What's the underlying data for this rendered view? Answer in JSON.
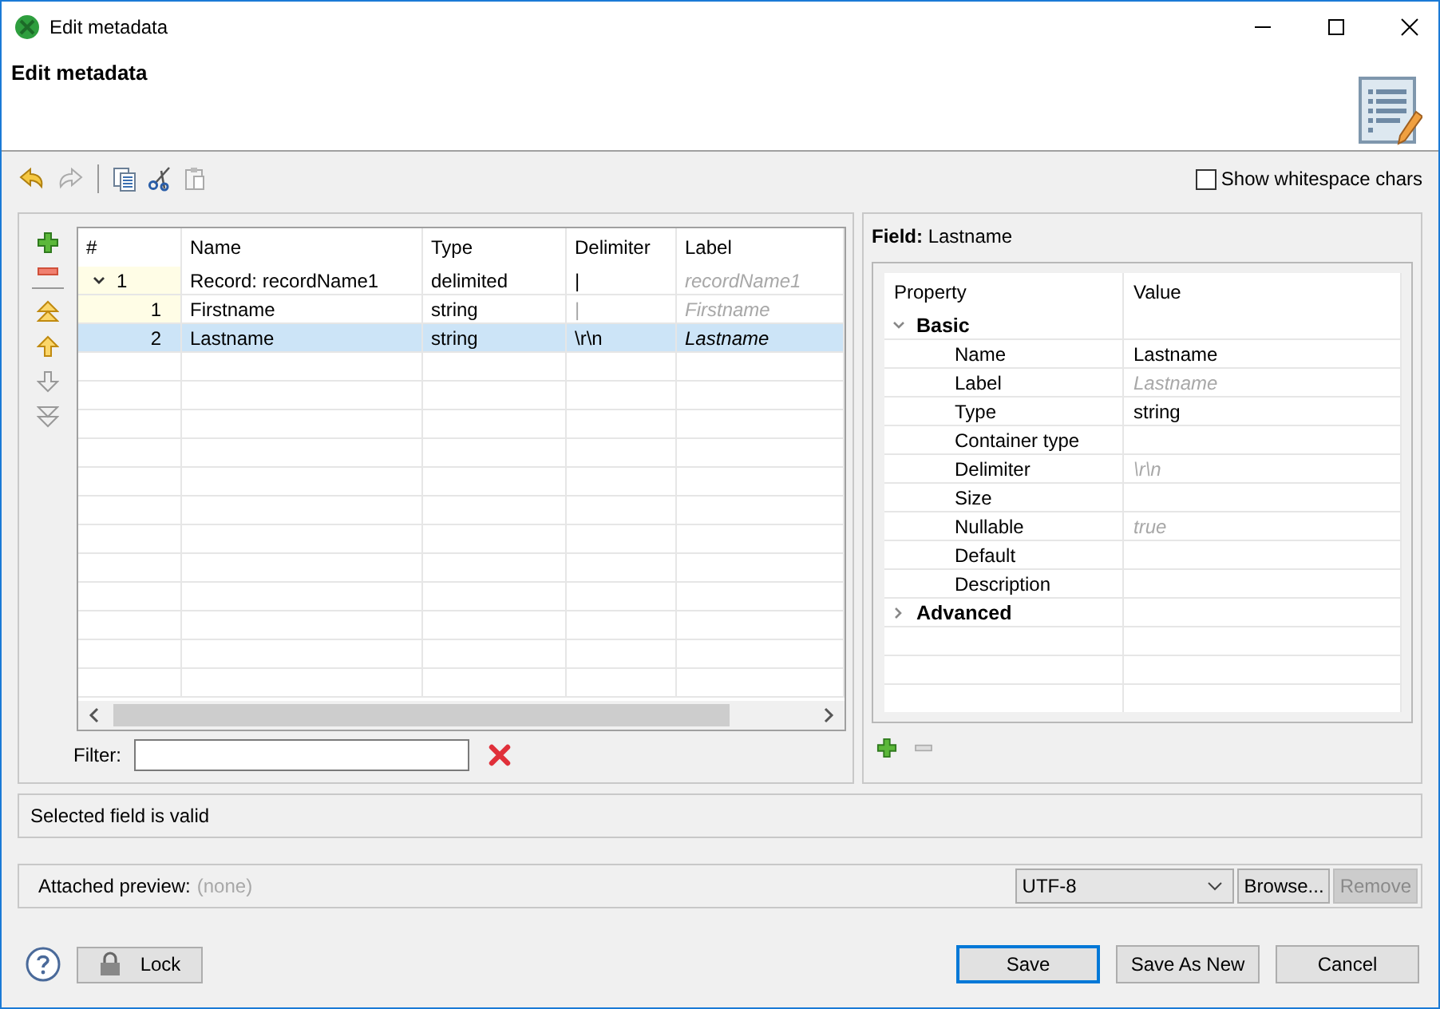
{
  "window": {
    "title": "Edit metadata"
  },
  "header": {
    "title": "Edit metadata"
  },
  "toolbar": [
    {
      "kind": "undo",
      "disabled": false
    },
    {
      "kind": "redo",
      "disabled": true
    },
    {
      "kind": "separator"
    },
    {
      "kind": "copy",
      "disabled": false
    },
    {
      "kind": "cut",
      "disabled": false
    },
    {
      "kind": "paste",
      "disabled": true
    }
  ],
  "show_whitespace": {
    "label": "Show whitespace chars",
    "checked": false
  },
  "side_buttons": [
    {
      "kind": "add",
      "disabled": false
    },
    {
      "kind": "remove",
      "disabled": false
    },
    {
      "kind": "separator"
    },
    {
      "kind": "top",
      "disabled": false
    },
    {
      "kind": "up",
      "disabled": false
    },
    {
      "kind": "down",
      "disabled": true
    },
    {
      "kind": "bottom",
      "disabled": true
    }
  ],
  "table": {
    "columns": [
      "#",
      "Name",
      "Type",
      "Delimiter",
      "Label"
    ],
    "rows": [
      {
        "number": "1",
        "name": "Record: recordName1",
        "type": "delimited",
        "delimiter": "|",
        "delimiter_default": false,
        "label": "recordName1",
        "selected": false,
        "expanded": true,
        "children": [
          {
            "number": "1",
            "name": "Firstname",
            "type": "string",
            "delimiter": "|",
            "delimiter_default": true,
            "label": "Firstname",
            "selected": false
          },
          {
            "number": "2",
            "name": "Lastname",
            "type": "string",
            "delimiter": "\\r\\n",
            "delimiter_default": false,
            "label": "Lastname",
            "selected": true
          }
        ]
      }
    ]
  },
  "filter": {
    "label": "Filter:"
  },
  "field_panel": {
    "title": "**Field:** Lastname",
    "columns": [
      "Property",
      "Value"
    ],
    "groups": [
      {
        "name": "Basic",
        "expanded": true,
        "items": [
          {
            "name": "Name",
            "value": "Lastname",
            "default": false
          },
          {
            "name": "Label",
            "value": "Lastname",
            "default": true
          },
          {
            "name": "Type",
            "value": "string",
            "default": false
          },
          {
            "name": "Container type"
          },
          {
            "name": "Delimiter",
            "value": "\\r\\n",
            "default": true
          },
          {
            "name": "Size"
          },
          {
            "name": "Nullable",
            "value": "true",
            "default": true
          },
          {
            "name": "Default"
          },
          {
            "name": "Description"
          }
        ]
      },
      {
        "name": "Advanced",
        "expanded": false
      }
    ],
    "buttons": [
      {
        "kind": "add",
        "disabled": false
      },
      {
        "kind": "remove",
        "disabled": true
      }
    ]
  },
  "status": "Selected field is valid",
  "preview": {
    "label": "Attached preview:",
    "value": "(none)",
    "encoding": "UTF-8",
    "browse": {
      "label": "Browse...",
      "disabled": false
    },
    "remove": {
      "label": "Remove",
      "disabled": true
    }
  },
  "footer": {
    "lock": "Lock",
    "buttons": [
      {
        "label": "Save",
        "default": true
      },
      {
        "label": "Save As New",
        "default": false
      },
      {
        "label": "Cancel",
        "default": false
      }
    ]
  }
}
